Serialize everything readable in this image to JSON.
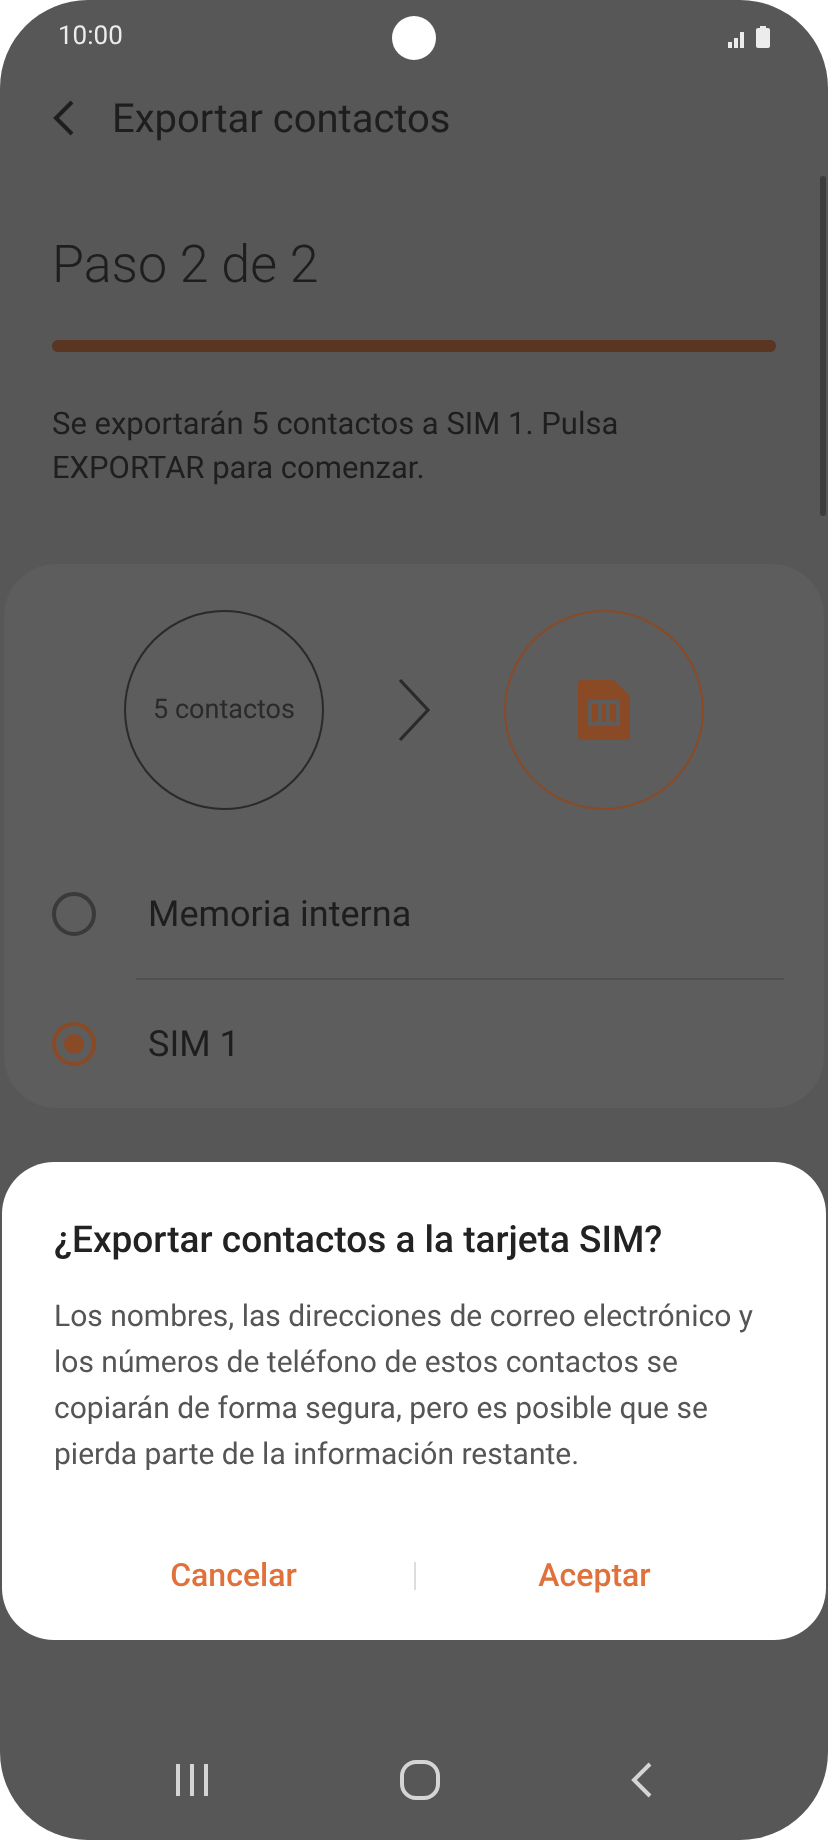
{
  "status_bar": {
    "time": "10:00"
  },
  "header": {
    "title": "Exportar contactos"
  },
  "step": {
    "title": "Paso 2 de 2",
    "level": 1
  },
  "description": "Se exportarán 5 contactos a SIM 1. Pulsa EXPORTAR para comenzar.",
  "transfer": {
    "source": "5 contactos"
  },
  "options": [
    {
      "label": "Memoria interna",
      "selected": false
    },
    {
      "label": "SIM 1",
      "selected": true
    }
  ],
  "dialog": {
    "title": "¿Exportar contactos a la tarjeta SIM?",
    "message": "Los nombres, las direcciones de correo electrónico y los números de teléfono de estos contactos se copiarán de forma segura, pero es posible que se pierda parte de la información restante.",
    "buttons": [
      "Cancelar",
      "Aceptar"
    ]
  }
}
